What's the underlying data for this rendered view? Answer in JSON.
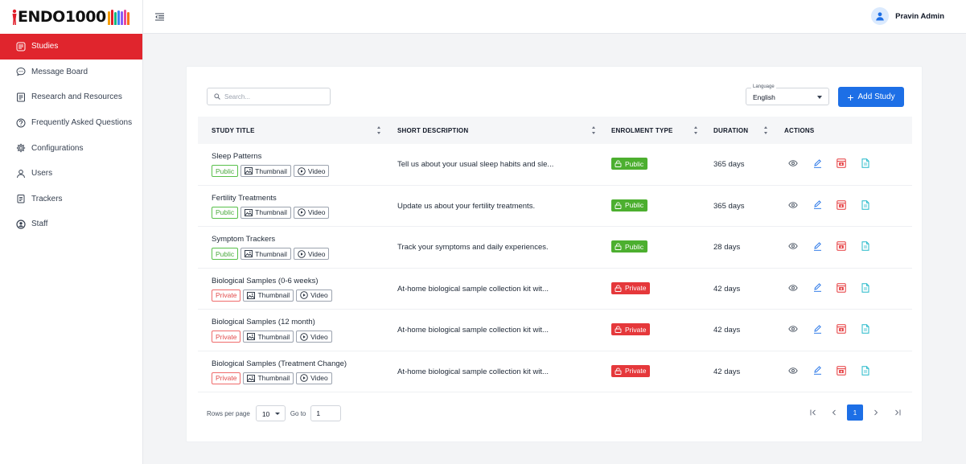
{
  "brand": {
    "prefix": "ENDO",
    "suffix": "1000"
  },
  "sidebar": {
    "items": [
      {
        "label": "Studies",
        "icon": "studies-icon",
        "active": true
      },
      {
        "label": "Message Board",
        "icon": "message-icon"
      },
      {
        "label": "Research and Resources",
        "icon": "document-icon"
      },
      {
        "label": "Frequently Asked Questions",
        "icon": "question-icon"
      },
      {
        "label": "Configurations",
        "icon": "gear-icon"
      },
      {
        "label": "Users",
        "icon": "user-icon"
      },
      {
        "label": "Trackers",
        "icon": "clipboard-icon"
      },
      {
        "label": "Staff",
        "icon": "staff-icon"
      }
    ]
  },
  "header": {
    "user_name": "Pravin Admin"
  },
  "toolbar": {
    "search_placeholder": "Search...",
    "language_label": "Language",
    "language_value": "English",
    "add_label": "Add Study"
  },
  "table": {
    "columns": [
      "STUDY TITLE",
      "SHORT DESCRIPTION",
      "ENROLMENT TYPE",
      "DURATION",
      "ACTIONS"
    ],
    "tag_labels": {
      "thumbnail": "Thumbnail",
      "video": "Video"
    },
    "rows": [
      {
        "title": "Sleep Patterns",
        "access": "Public",
        "description": "Tell us about your usual sleep habits and sle...",
        "enrolment": "Public",
        "duration": "365 days"
      },
      {
        "title": "Fertility Treatments",
        "access": "Public",
        "description": "Update us about your fertility treatments.",
        "enrolment": "Public",
        "duration": "365 days"
      },
      {
        "title": "Symptom Trackers",
        "access": "Public",
        "description": "Track your symptoms and daily experiences.",
        "enrolment": "Public",
        "duration": "28 days"
      },
      {
        "title": "Biological Samples (0-6 weeks)",
        "access": "Private",
        "description": "At-home biological sample collection kit wit...",
        "enrolment": "Private",
        "duration": "42 days"
      },
      {
        "title": "Biological Samples (12 month)",
        "access": "Private",
        "description": "At-home biological sample collection kit wit...",
        "enrolment": "Private",
        "duration": "42 days"
      },
      {
        "title": "Biological Samples (Treatment Change)",
        "access": "Private",
        "description": "At-home biological sample collection kit wit...",
        "enrolment": "Private",
        "duration": "42 days"
      }
    ]
  },
  "pagination": {
    "rows_per_page_label": "Rows per page",
    "rows_per_page_value": "10",
    "goto_label": "Go to",
    "goto_value": "1",
    "current_page": "1"
  },
  "colors": {
    "accent_red": "#e0252d",
    "primary_blue": "#1d6fe6",
    "public_green": "#4caf2f",
    "private_red": "#e5383b"
  }
}
